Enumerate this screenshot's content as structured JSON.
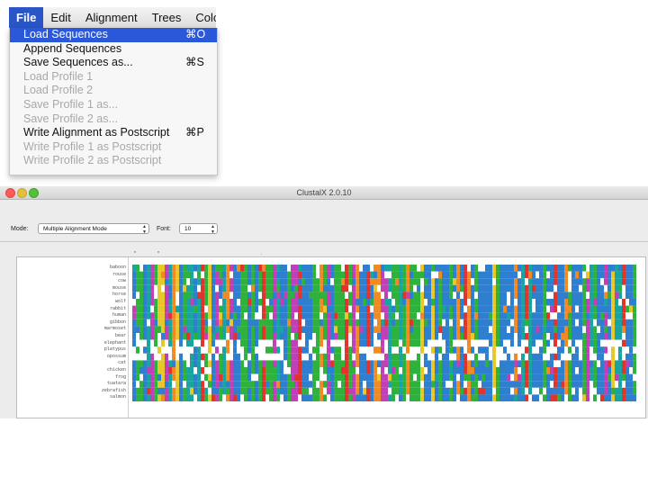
{
  "menubar": {
    "items": [
      "File",
      "Edit",
      "Alignment",
      "Trees",
      "Color"
    ],
    "active_index": 0
  },
  "file_menu": {
    "items": [
      {
        "label": "Load Sequences",
        "shortcut": "⌘O",
        "enabled": true,
        "highlighted": true
      },
      {
        "label": "Append Sequences",
        "shortcut": "",
        "enabled": true,
        "highlighted": false
      },
      {
        "label": "Save Sequences as...",
        "shortcut": "⌘S",
        "enabled": true,
        "highlighted": false
      },
      {
        "label": "Load Profile 1",
        "shortcut": "",
        "enabled": false,
        "highlighted": false
      },
      {
        "label": "Load Profile 2",
        "shortcut": "",
        "enabled": false,
        "highlighted": false
      },
      {
        "label": "Save Profile 1 as...",
        "shortcut": "",
        "enabled": false,
        "highlighted": false
      },
      {
        "label": "Save Profile 2 as...",
        "shortcut": "",
        "enabled": false,
        "highlighted": false
      },
      {
        "label": "Write Alignment as Postscript",
        "shortcut": "⌘P",
        "enabled": true,
        "highlighted": false
      },
      {
        "label": "Write Profile 1 as Postscript",
        "shortcut": "",
        "enabled": false,
        "highlighted": false
      },
      {
        "label": "Write Profile 2 as Postscript",
        "shortcut": "",
        "enabled": false,
        "highlighted": false
      }
    ]
  },
  "window": {
    "title": "ClustalX 2.0.10",
    "mode_label": "Mode:",
    "mode_value": "Multiple Alignment Mode",
    "font_label": "Font:",
    "font_value": "10"
  },
  "alignment": {
    "sequence_names": [
      "baboon",
      "rouse",
      "cow",
      "mouse",
      "horse",
      "wolf",
      "rabbit",
      "human",
      "gibbon",
      "marmoset",
      "bear",
      "elephant",
      "platypus",
      "opossum",
      "cat",
      "chicken",
      "frog",
      "tuatara",
      "zebrafish",
      "salmon"
    ],
    "residue_colors": {
      "blue": "#2e7fd0",
      "green": "#2fb23c",
      "red": "#e0352c",
      "magenta": "#c040b8",
      "orange": "#f08a24",
      "cyan": "#19a4a0",
      "yellow": "#e7c72a",
      "gap": "#ffffff"
    }
  }
}
